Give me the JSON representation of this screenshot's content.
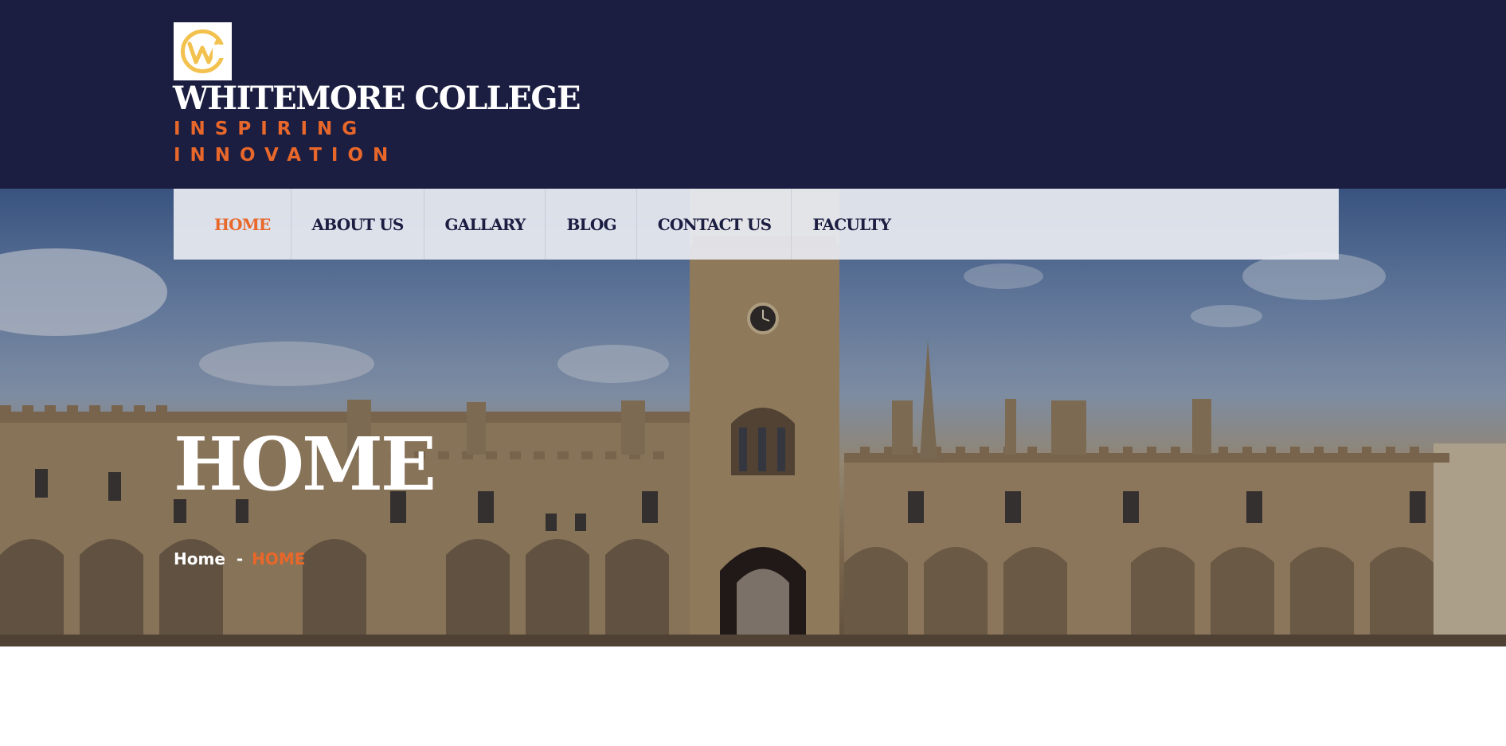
{
  "brand": {
    "name": "WHITEMORE COLLEGE",
    "tagline": "INSPIRING INNOVATION",
    "logo_icon": "college-logo-w-icon",
    "logo_color": "#f2c14e"
  },
  "nav": {
    "items": [
      {
        "label": "HOME",
        "active": true
      },
      {
        "label": "ABOUT US",
        "active": false
      },
      {
        "label": "GALLARY",
        "active": false
      },
      {
        "label": "BLOG",
        "active": false
      },
      {
        "label": "CONTACT US",
        "active": false
      },
      {
        "label": "FACULTY",
        "active": false
      }
    ]
  },
  "hero": {
    "title": "HOME",
    "image_subject": "college-building-image",
    "breadcrumb": {
      "home": "Home",
      "separator": "-",
      "current": "HOME"
    }
  },
  "colors": {
    "header_bg": "#1b1d41",
    "accent": "#e8672a",
    "nav_bg": "#e8ebf1",
    "text_dark": "#1b1d41"
  }
}
